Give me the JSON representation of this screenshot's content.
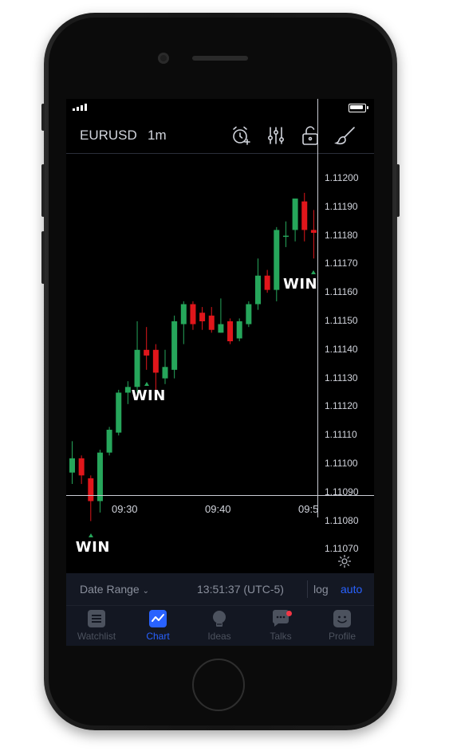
{
  "toolbar": {
    "symbol": "EURUSD",
    "interval": "1m",
    "icons": [
      "alarm-add-icon",
      "indicators-icon",
      "unlock-icon",
      "drawing-brush-icon"
    ]
  },
  "chart_data": {
    "type": "candlestick",
    "price_ticks": [
      "1.11200",
      "1.11190",
      "1.11180",
      "1.11170",
      "1.11160",
      "1.11150",
      "1.11140",
      "1.11130",
      "1.11120",
      "1.11110",
      "1.11100",
      "1.11090",
      "1.11080",
      "1.11070"
    ],
    "time_ticks": [
      "09:30",
      "09:40",
      "09:5"
    ],
    "up_color": "#26a65b",
    "down_color": "#e0161b",
    "candles": [
      {
        "o": 1.11097,
        "c": 1.11102,
        "h": 1.11108,
        "l": 1.11093
      },
      {
        "o": 1.11102,
        "c": 1.11096,
        "h": 1.11103,
        "l": 1.11093
      },
      {
        "o": 1.11095,
        "c": 1.11087,
        "h": 1.11096,
        "l": 1.1108
      },
      {
        "o": 1.11087,
        "c": 1.11104,
        "h": 1.11105,
        "l": 1.11083
      },
      {
        "o": 1.11104,
        "c": 1.11112,
        "h": 1.11113,
        "l": 1.11103
      },
      {
        "o": 1.11111,
        "c": 1.11125,
        "h": 1.11126,
        "l": 1.1111
      },
      {
        "o": 1.11125,
        "c": 1.11127,
        "h": 1.11129,
        "l": 1.11121
      },
      {
        "o": 1.11127,
        "c": 1.1114,
        "h": 1.1115,
        "l": 1.11125
      },
      {
        "o": 1.1114,
        "c": 1.11138,
        "h": 1.11148,
        "l": 1.11133
      },
      {
        "o": 1.1114,
        "c": 1.11132,
        "h": 1.11142,
        "l": 1.11126
      },
      {
        "o": 1.1113,
        "c": 1.11134,
        "h": 1.1114,
        "l": 1.11128
      },
      {
        "o": 1.11133,
        "c": 1.1115,
        "h": 1.11152,
        "l": 1.1113
      },
      {
        "o": 1.11149,
        "c": 1.11156,
        "h": 1.11157,
        "l": 1.11142
      },
      {
        "o": 1.11156,
        "c": 1.11149,
        "h": 1.11157,
        "l": 1.11147
      },
      {
        "o": 1.11153,
        "c": 1.1115,
        "h": 1.11155,
        "l": 1.11147
      },
      {
        "o": 1.11152,
        "c": 1.11147,
        "h": 1.11155,
        "l": 1.11146
      },
      {
        "o": 1.11146,
        "c": 1.11149,
        "h": 1.11158,
        "l": 1.11146
      },
      {
        "o": 1.1115,
        "c": 1.11143,
        "h": 1.11151,
        "l": 1.11142
      },
      {
        "o": 1.11144,
        "c": 1.1115,
        "h": 1.11151,
        "l": 1.11143
      },
      {
        "o": 1.11149,
        "c": 1.11156,
        "h": 1.11157,
        "l": 1.11148
      },
      {
        "o": 1.11156,
        "c": 1.11166,
        "h": 1.11172,
        "l": 1.11154
      },
      {
        "o": 1.11166,
        "c": 1.11161,
        "h": 1.11168,
        "l": 1.1116
      },
      {
        "o": 1.11161,
        "c": 1.11182,
        "h": 1.11183,
        "l": 1.11157
      },
      {
        "o": 1.1118,
        "c": 1.1118,
        "h": 1.11185,
        "l": 1.11176
      },
      {
        "o": 1.11182,
        "c": 1.11193,
        "h": 1.11193,
        "l": 1.11178
      },
      {
        "o": 1.11192,
        "c": 1.11182,
        "h": 1.11195,
        "l": 1.11178
      },
      {
        "o": 1.11182,
        "c": 1.11181,
        "h": 1.11189,
        "l": 1.11172
      }
    ],
    "markers": [
      {
        "label": "WIN",
        "candle": 2
      },
      {
        "label": "WIN",
        "candle": 8
      },
      {
        "label": "WIN",
        "candle": 26
      }
    ]
  },
  "info_bar": {
    "date_range": "Date Range",
    "clock": "13:51:37 (UTC-5)",
    "log": "log",
    "auto": "auto"
  },
  "tabs": [
    {
      "label": "Watchlist",
      "icon": "watchlist-icon",
      "active": false
    },
    {
      "label": "Chart",
      "icon": "chart-icon",
      "active": true
    },
    {
      "label": "Ideas",
      "icon": "ideas-icon",
      "active": false
    },
    {
      "label": "Talks",
      "icon": "talks-icon",
      "active": false,
      "badge": true
    },
    {
      "label": "Profile",
      "icon": "profile-icon",
      "active": false
    }
  ]
}
